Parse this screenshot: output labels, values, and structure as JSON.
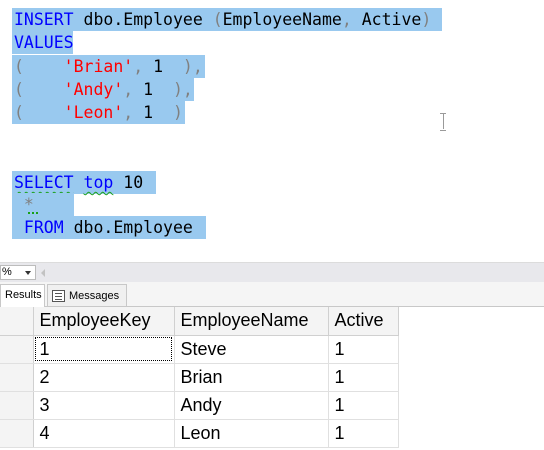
{
  "editor": {
    "lines": [
      {
        "segments": [
          {
            "t": "INSERT",
            "c": "kw"
          },
          {
            "t": " dbo.Employee ",
            "c": "txt-default"
          },
          {
            "t": "(",
            "c": "gry"
          },
          {
            "t": "EmployeeName",
            "c": "txt-default"
          },
          {
            "t": ", ",
            "c": "gry"
          },
          {
            "t": "Active",
            "c": "txt-default"
          },
          {
            "t": ")",
            "c": "gry"
          }
        ]
      },
      {
        "segments": [
          {
            "t": "VALUES",
            "c": "kw"
          }
        ]
      },
      {
        "segments": [
          {
            "t": "(    ",
            "c": "gry"
          },
          {
            "t": "'Brian'",
            "c": "str"
          },
          {
            "t": ", ",
            "c": "gry"
          },
          {
            "t": "1",
            "c": "txt-default"
          },
          {
            "t": "  ),",
            "c": "gry"
          }
        ]
      },
      {
        "segments": [
          {
            "t": "(    ",
            "c": "gry"
          },
          {
            "t": "'Andy'",
            "c": "str"
          },
          {
            "t": ", ",
            "c": "gry"
          },
          {
            "t": "1",
            "c": "txt-default"
          },
          {
            "t": "  ),",
            "c": "gry"
          }
        ]
      },
      {
        "segments": [
          {
            "t": "(    ",
            "c": "gry"
          },
          {
            "t": "'Leon'",
            "c": "str"
          },
          {
            "t": ", ",
            "c": "gry"
          },
          {
            "t": "1",
            "c": "txt-default"
          },
          {
            "t": "  )",
            "c": "gry"
          }
        ]
      },
      {
        "segments": []
      },
      {
        "segments": []
      },
      {
        "segments": [
          {
            "t": "SELECT",
            "c": "kw squiggle"
          },
          {
            "t": " ",
            "c": "txt-default"
          },
          {
            "t": "top",
            "c": "kw squiggle"
          },
          {
            "t": " 10",
            "c": "txt-default"
          }
        ]
      },
      {
        "segments": [
          {
            "t": " *",
            "c": "gry"
          }
        ]
      },
      {
        "segments": [
          {
            "t": " FROM",
            "c": "kw"
          },
          {
            "t": " dbo.Employee",
            "c": "txt-default"
          }
        ]
      }
    ]
  },
  "zoom": {
    "value": "%"
  },
  "tabs": {
    "results_label": "Results",
    "messages_label": "Messages"
  },
  "grid": {
    "columns": [
      "EmployeeKey",
      "EmployeeName",
      "Active"
    ],
    "rows": [
      [
        "1",
        "Steve",
        "1"
      ],
      [
        "2",
        "Brian",
        "1"
      ],
      [
        "3",
        "Andy",
        "1"
      ],
      [
        "4",
        "Leon",
        "1"
      ]
    ]
  },
  "colors": {
    "selection": "#99c9ef",
    "keyword": "#0000ff",
    "string": "#ff0000",
    "punctuation": "#808080"
  }
}
